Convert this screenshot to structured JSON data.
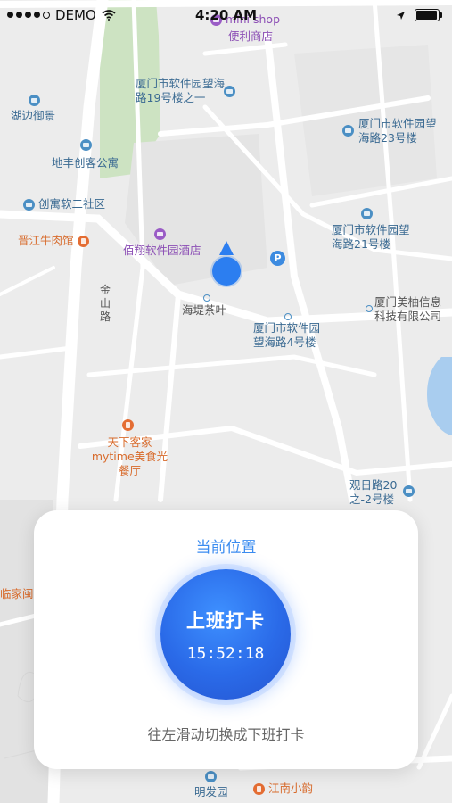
{
  "status_bar": {
    "carrier": "DEMO",
    "time": "4:20 AM",
    "signal_dots_filled": 4,
    "signal_dots_total": 5,
    "battery_level": 0.95
  },
  "map": {
    "pois": [
      {
        "name": "便利商店",
        "extra": "mini shop",
        "color": "purple"
      },
      {
        "name": "厦门市软件园望海路19号楼之一",
        "color": "blue"
      },
      {
        "name": "湖边御景",
        "color": "blue"
      },
      {
        "name": "厦门市软件园望海路23号楼",
        "color": "blue"
      },
      {
        "name": "地丰创客公寓",
        "color": "blue"
      },
      {
        "name": "创寓软二社区",
        "color": "blue"
      },
      {
        "name": "厦门市软件园望海路21号楼",
        "color": "blue"
      },
      {
        "name": "晋江牛肉馆",
        "color": "orange"
      },
      {
        "name": "佰翔软件园酒店",
        "color": "purple"
      },
      {
        "name": "金山路",
        "color": "grey"
      },
      {
        "name": "海堤茶叶",
        "color": "grey"
      },
      {
        "name": "厦门美柚信息科技有限公司",
        "color": "grey"
      },
      {
        "name": "厦门市软件园望海路4号楼",
        "color": "blue"
      },
      {
        "name": "天下客家mytime美食光餐厅",
        "color": "orange"
      },
      {
        "name": "观日路20之-2号楼",
        "color": "blue"
      },
      {
        "name": "临家闽",
        "color": "orange"
      },
      {
        "name": "明发园",
        "color": "blue"
      },
      {
        "name": "江南小韵",
        "color": "orange"
      }
    ],
    "parking_label": "P"
  },
  "card": {
    "title": "当前位置",
    "clock_label": "上班打卡",
    "clock_time": "15:52:18",
    "hint": "往左滑动切换成下班打卡"
  }
}
